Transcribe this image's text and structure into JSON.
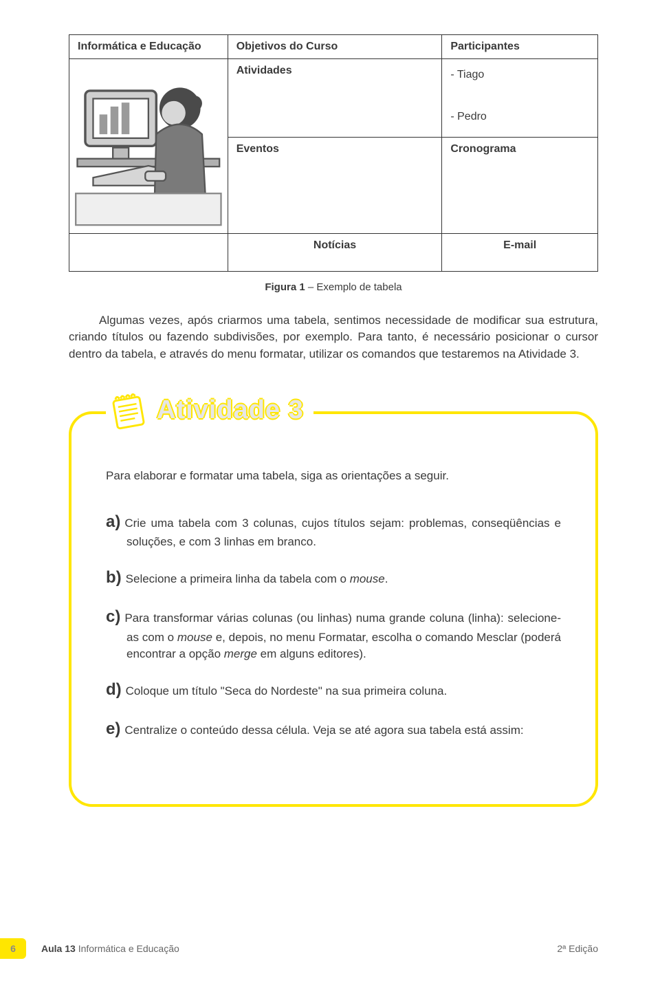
{
  "table": {
    "r1c1": "Informática e Educação",
    "r1c2": "Objetivos do Curso",
    "r1c3": "Participantes",
    "r2c2": "Atividades",
    "participant1": "- Tiago",
    "participant2": "- Pedro",
    "r3c2": "Eventos",
    "r3c3": "Cronograma",
    "r4c2": "Notícias",
    "r4c3": "E-mail"
  },
  "caption_bold": "Figura 1",
  "caption_rest": " – Exemplo de tabela",
  "paragraph": "Algumas vezes, após criarmos uma tabela, sentimos necessidade de modificar sua estrutura, criando títulos ou fazendo subdivisões,  por exemplo. Para tanto, é necessário posicionar o cursor dentro da tabela, e através do menu formatar, utilizar os comandos que testaremos na Atividade 3.",
  "activity": {
    "title": "Atividade 3",
    "intro": "Para elaborar e formatar uma tabela, siga as orientações a seguir.",
    "items": [
      {
        "marker": "a)",
        "text": "Crie uma tabela com 3 colunas, cujos títulos sejam: problemas, conseqüências e soluções, e com 3 linhas em branco."
      },
      {
        "marker": "b)",
        "html": "Selecione a primeira linha da tabela com o <em>mouse</em>."
      },
      {
        "marker": "c)",
        "html": "Para transformar várias colunas (ou linhas) numa grande coluna (linha): selecione-as com o <em>mouse</em> e, depois, no menu Formatar, escolha o comando Mesclar  (poderá encontrar a opção <em>merge</em> em alguns editores)."
      },
      {
        "marker": "d)",
        "text": "Coloque um título \"Seca do Nordeste\" na sua primeira coluna."
      },
      {
        "marker": "e)",
        "text": "Centralize o conteúdo dessa célula. Veja se até agora sua tabela está assim:"
      }
    ]
  },
  "footer": {
    "page_number": "6",
    "lesson_bold": "Aula 13",
    "lesson_rest": "   Informática e Educação",
    "edition": "2ª Edição"
  }
}
